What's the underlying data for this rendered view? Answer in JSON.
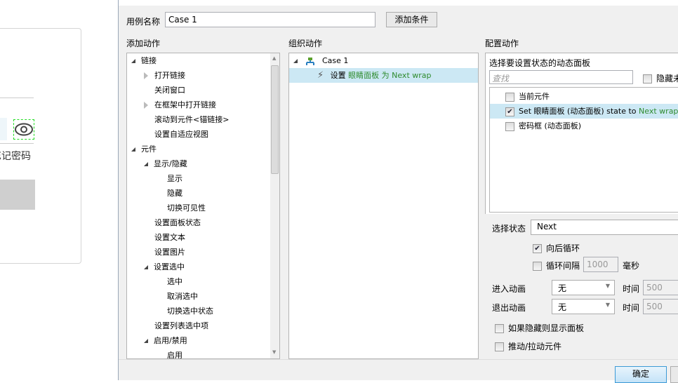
{
  "canvas": {
    "forgot_password": "忘记密码"
  },
  "dialog": {
    "case_name_label": "用例名称",
    "case_name_value": "Case 1",
    "add_condition": "添加条件",
    "add_action_title": "添加动作",
    "organize_title": "组织动作",
    "configure_title": "配置动作",
    "action_tree": [
      {
        "label": "链接",
        "level": 0,
        "toggle": "expanded"
      },
      {
        "label": "打开链接",
        "level": 1,
        "toggle": "collapsed"
      },
      {
        "label": "关闭窗口",
        "level": 1,
        "toggle": "none"
      },
      {
        "label": "在框架中打开链接",
        "level": 1,
        "toggle": "collapsed"
      },
      {
        "label": "滚动到元件<锚链接>",
        "level": 1,
        "toggle": "none"
      },
      {
        "label": "设置自适应视图",
        "level": 1,
        "toggle": "none"
      },
      {
        "label": "元件",
        "level": 0,
        "toggle": "expanded"
      },
      {
        "label": "显示/隐藏",
        "level": 1,
        "toggle": "expanded"
      },
      {
        "label": "显示",
        "level": 2,
        "toggle": "none"
      },
      {
        "label": "隐藏",
        "level": 2,
        "toggle": "none"
      },
      {
        "label": "切换可见性",
        "level": 2,
        "toggle": "none"
      },
      {
        "label": "设置面板状态",
        "level": 1,
        "toggle": "none"
      },
      {
        "label": "设置文本",
        "level": 1,
        "toggle": "none"
      },
      {
        "label": "设置图片",
        "level": 1,
        "toggle": "none"
      },
      {
        "label": "设置选中",
        "level": 1,
        "toggle": "expanded"
      },
      {
        "label": "选中",
        "level": 2,
        "toggle": "none"
      },
      {
        "label": "取消选中",
        "level": 2,
        "toggle": "none"
      },
      {
        "label": "切换选中状态",
        "level": 2,
        "toggle": "none"
      },
      {
        "label": "设置列表选中项",
        "level": 1,
        "toggle": "none"
      },
      {
        "label": "启用/禁用",
        "level": 1,
        "toggle": "expanded"
      },
      {
        "label": "启用",
        "level": 2,
        "toggle": "none"
      }
    ],
    "organize": {
      "case": "Case 1",
      "action_prefix": "设置",
      "action_target": "眼睛面板 为 Next wrap"
    },
    "configure": {
      "panel_title": "选择要设置状态的动态面板",
      "search_placeholder": "查找",
      "hide_unnamed": "隐藏未命名",
      "panels": [
        {
          "prefix": "当前元件",
          "suffix": "",
          "checked": false
        },
        {
          "prefix": "Set 眼睛面板 (动态面板) state to ",
          "suffix": "Next wrap",
          "checked": true
        },
        {
          "prefix": "密码框 (动态面板)",
          "suffix": "",
          "checked": false
        }
      ],
      "select_state_label": "选择状态",
      "select_state_value": "Next",
      "wrap_label": "向后循环",
      "wrap_checked": true,
      "interval_label": "循环间隔",
      "interval_value": "1000",
      "interval_unit": "毫秒",
      "interval_checked": false,
      "enter_anim_label": "进入动画",
      "enter_anim_value": "无",
      "time_label": "时间",
      "enter_time": "500",
      "exit_anim_label": "退出动画",
      "exit_anim_value": "无",
      "exit_time": "500",
      "show_if_hidden": "如果隐藏则显示面板",
      "push_pull": "推动/拉动元件"
    },
    "ok": "确定"
  },
  "colors": {
    "selection": "#cce8f4",
    "accent_green": "#2e8b2e"
  }
}
